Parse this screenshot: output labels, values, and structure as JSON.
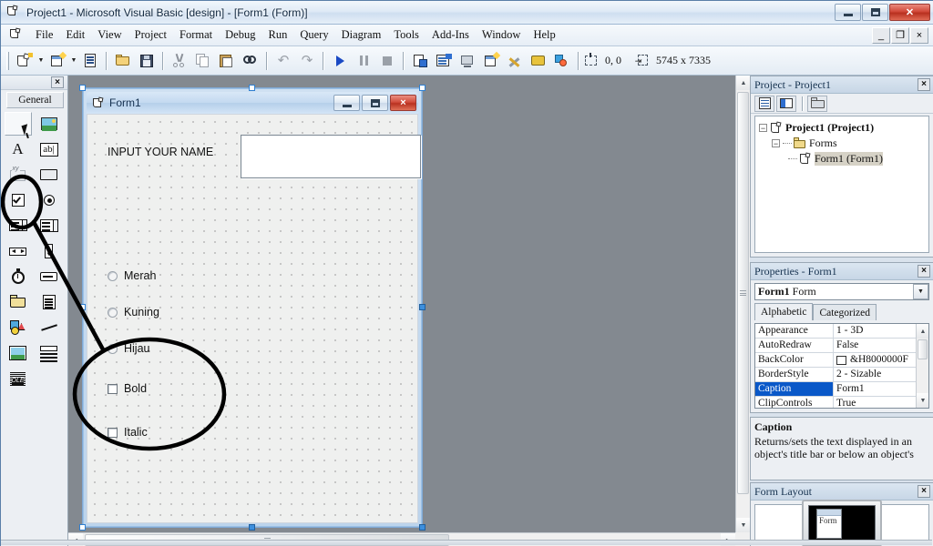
{
  "window": {
    "title": "Project1 - Microsoft Visual Basic [design] - [Form1 (Form)]",
    "app_icon": "vb-project-icon",
    "minimize": "minimize-icon",
    "maximize": "maximize-icon",
    "close": "close-icon"
  },
  "menubar": {
    "icon": "vb-document-icon",
    "items": [
      {
        "label": "File"
      },
      {
        "label": "Edit"
      },
      {
        "label": "View"
      },
      {
        "label": "Project"
      },
      {
        "label": "Format"
      },
      {
        "label": "Debug"
      },
      {
        "label": "Run"
      },
      {
        "label": "Query"
      },
      {
        "label": "Diagram"
      },
      {
        "label": "Tools"
      },
      {
        "label": "Add-Ins"
      },
      {
        "label": "Window"
      },
      {
        "label": "Help"
      }
    ],
    "mdi_minimize": "_",
    "mdi_restore": "❐",
    "mdi_close": "×"
  },
  "toolbar": {
    "buttons": [
      {
        "name": "add-project-button",
        "icon": "add-project-icon"
      },
      {
        "name": "add-form-button",
        "icon": "add-form-icon"
      },
      {
        "name": "menu-editor-button",
        "icon": "menu-editor-icon"
      },
      {
        "name": "open-project-button",
        "icon": "open-folder-icon"
      },
      {
        "name": "save-project-button",
        "icon": "floppy-disk-icon"
      },
      {
        "name": "cut-button",
        "icon": "scissors-icon"
      },
      {
        "name": "copy-button",
        "icon": "copy-pages-icon"
      },
      {
        "name": "paste-button",
        "icon": "clipboard-icon"
      },
      {
        "name": "find-button",
        "icon": "binoculars-icon"
      },
      {
        "name": "undo-button",
        "icon": "undo-arrow-icon"
      },
      {
        "name": "redo-button",
        "icon": "redo-arrow-icon"
      },
      {
        "name": "start-button",
        "icon": "play-triangle-icon"
      },
      {
        "name": "break-button",
        "icon": "pause-icon"
      },
      {
        "name": "end-button",
        "icon": "stop-square-icon"
      },
      {
        "name": "project-explorer-button",
        "icon": "project-explorer-icon"
      },
      {
        "name": "properties-window-button",
        "icon": "properties-window-icon"
      },
      {
        "name": "form-layout-button",
        "icon": "form-layout-icon"
      },
      {
        "name": "object-browser-button",
        "icon": "object-browser-icon"
      },
      {
        "name": "toolbox-button",
        "icon": "toolbox-hammer-icon"
      },
      {
        "name": "data-view-button",
        "icon": "data-view-icon"
      },
      {
        "name": "visual-component-manager-button",
        "icon": "component-manager-icon"
      }
    ],
    "position_icon": "form-position-icon",
    "position_value": "0, 0",
    "size_icon": "form-size-icon",
    "size_value": "5745 x 7335"
  },
  "toolbox": {
    "close": "×",
    "tab_label": "General",
    "tools": [
      {
        "name": "tool-pointer",
        "label": "Pointer",
        "icon": "pointer-icon",
        "selected": true
      },
      {
        "name": "tool-picturebox",
        "label": "PictureBox",
        "icon": "picturebox-icon"
      },
      {
        "name": "tool-label",
        "label": "Label",
        "icon": "label-a-icon"
      },
      {
        "name": "tool-textbox",
        "label": "TextBox",
        "icon": "textbox-abl-icon"
      },
      {
        "name": "tool-frame",
        "label": "Frame",
        "icon": "frame-icon"
      },
      {
        "name": "tool-commandbutton",
        "label": "CommandButton",
        "icon": "commandbutton-icon"
      },
      {
        "name": "tool-checkbox",
        "label": "CheckBox",
        "icon": "checkbox-icon",
        "annotated": true
      },
      {
        "name": "tool-optionbutton",
        "label": "OptionButton",
        "icon": "optionbutton-icon"
      },
      {
        "name": "tool-combobox",
        "label": "ComboBox",
        "icon": "combobox-icon"
      },
      {
        "name": "tool-listbox",
        "label": "ListBox",
        "icon": "listbox-icon"
      },
      {
        "name": "tool-hscrollbar",
        "label": "HScrollBar",
        "icon": "hscrollbar-icon"
      },
      {
        "name": "tool-vscrollbar",
        "label": "VScrollBar",
        "icon": "vscrollbar-icon"
      },
      {
        "name": "tool-timer",
        "label": "Timer",
        "icon": "stopwatch-icon"
      },
      {
        "name": "tool-drivelistbox",
        "label": "DriveListBox",
        "icon": "drivelistbox-icon"
      },
      {
        "name": "tool-dirlistbox",
        "label": "DirListBox",
        "icon": "folder-icon"
      },
      {
        "name": "tool-filelistbox",
        "label": "FileListBox",
        "icon": "file-page-icon"
      },
      {
        "name": "tool-shape",
        "label": "Shape",
        "icon": "shapes-icon"
      },
      {
        "name": "tool-line",
        "label": "Line",
        "icon": "line-icon"
      },
      {
        "name": "tool-image",
        "label": "Image",
        "icon": "image-icon"
      },
      {
        "name": "tool-data",
        "label": "Data",
        "icon": "data-control-icon"
      },
      {
        "name": "tool-ole",
        "label": "OLE",
        "icon": "ole-icon"
      }
    ]
  },
  "form": {
    "title": "Form1",
    "icon": "form-icon",
    "minimize": "minimize-icon",
    "maximize": "maximize-icon",
    "close": "×",
    "label_name": "INPUT YOUR NAME",
    "textbox_value": "",
    "options": [
      {
        "label": "Merah",
        "checked": false
      },
      {
        "label": "Kuning",
        "checked": false
      },
      {
        "label": "Hijau",
        "checked": false
      }
    ],
    "checkboxes": [
      {
        "label": "Bold",
        "checked": false
      },
      {
        "label": "Italic",
        "checked": false
      }
    ]
  },
  "project_explorer": {
    "title": "Project - Project1",
    "close": "×",
    "toolbar": [
      {
        "name": "view-code-button",
        "icon": "view-code-icon"
      },
      {
        "name": "view-object-button",
        "icon": "view-object-icon"
      },
      {
        "name": "toggle-folders-button",
        "icon": "toggle-folders-icon"
      }
    ],
    "tree": [
      {
        "label": "Project1 (Project1)",
        "expander": "−",
        "icon": "project-icon",
        "bold": true,
        "indent": 0
      },
      {
        "label": "Forms",
        "expander": "−",
        "icon": "folder-icon",
        "bold": false,
        "indent": 1
      },
      {
        "label": "Form1 (Form1)",
        "expander": "",
        "icon": "form-icon",
        "bold": false,
        "indent": 2,
        "selected": true
      }
    ]
  },
  "properties": {
    "title": "Properties - Form1",
    "close": "×",
    "object_name": "Form1",
    "object_type": "Form",
    "dropdown_icon": "chevron-down-icon",
    "tabs": [
      {
        "label": "Alphabetic",
        "active": true
      },
      {
        "label": "Categorized",
        "active": false
      }
    ],
    "rows": [
      {
        "name": "Appearance",
        "value": "1 - 3D",
        "selected": false
      },
      {
        "name": "AutoRedraw",
        "value": "False",
        "selected": false
      },
      {
        "name": "BackColor",
        "value": "&H8000000F",
        "selected": false,
        "swatch": "#ffffff"
      },
      {
        "name": "BorderStyle",
        "value": "2 - Sizable",
        "selected": false
      },
      {
        "name": "Caption",
        "value": "Form1",
        "selected": true
      },
      {
        "name": "ClipControls",
        "value": "True",
        "selected": false
      }
    ],
    "scroll_up": "▲",
    "scroll_down": "▼"
  },
  "description": {
    "title": "Caption",
    "text": "Returns/sets the text displayed in an object's title bar or below an object's"
  },
  "form_layout": {
    "title": "Form Layout",
    "close": "×",
    "form_caption": "Form"
  },
  "scrollbars": {
    "up": "▲",
    "down": "▼",
    "left": "◄",
    "right": "►"
  },
  "colors": {
    "accent": "#0a58c8",
    "title_text": "#12283f",
    "form_chrome": "#bcd4ec",
    "close_red": "#c0392b"
  }
}
